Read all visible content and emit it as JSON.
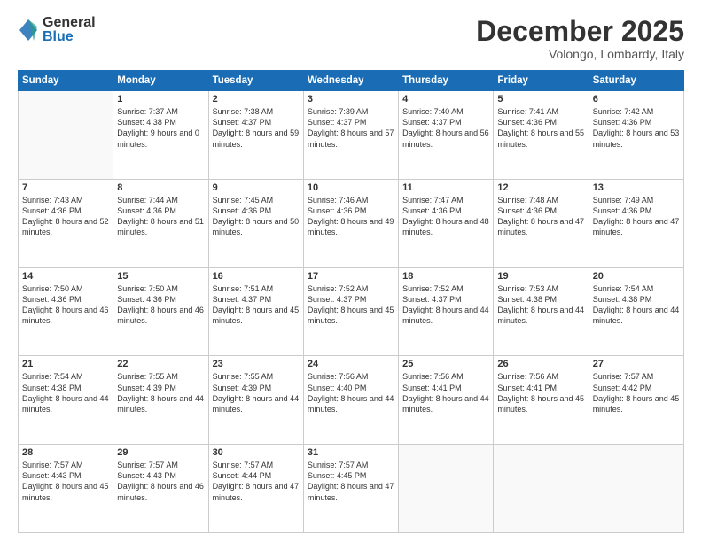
{
  "logo": {
    "general": "General",
    "blue": "Blue"
  },
  "header": {
    "month": "December 2025",
    "location": "Volongo, Lombardy, Italy"
  },
  "weekdays": [
    "Sunday",
    "Monday",
    "Tuesday",
    "Wednesday",
    "Thursday",
    "Friday",
    "Saturday"
  ],
  "weeks": [
    [
      {
        "day": "",
        "sunrise": "",
        "sunset": "",
        "daylight": ""
      },
      {
        "day": "1",
        "sunrise": "Sunrise: 7:37 AM",
        "sunset": "Sunset: 4:38 PM",
        "daylight": "Daylight: 9 hours and 0 minutes."
      },
      {
        "day": "2",
        "sunrise": "Sunrise: 7:38 AM",
        "sunset": "Sunset: 4:37 PM",
        "daylight": "Daylight: 8 hours and 59 minutes."
      },
      {
        "day": "3",
        "sunrise": "Sunrise: 7:39 AM",
        "sunset": "Sunset: 4:37 PM",
        "daylight": "Daylight: 8 hours and 57 minutes."
      },
      {
        "day": "4",
        "sunrise": "Sunrise: 7:40 AM",
        "sunset": "Sunset: 4:37 PM",
        "daylight": "Daylight: 8 hours and 56 minutes."
      },
      {
        "day": "5",
        "sunrise": "Sunrise: 7:41 AM",
        "sunset": "Sunset: 4:36 PM",
        "daylight": "Daylight: 8 hours and 55 minutes."
      },
      {
        "day": "6",
        "sunrise": "Sunrise: 7:42 AM",
        "sunset": "Sunset: 4:36 PM",
        "daylight": "Daylight: 8 hours and 53 minutes."
      }
    ],
    [
      {
        "day": "7",
        "sunrise": "Sunrise: 7:43 AM",
        "sunset": "Sunset: 4:36 PM",
        "daylight": "Daylight: 8 hours and 52 minutes."
      },
      {
        "day": "8",
        "sunrise": "Sunrise: 7:44 AM",
        "sunset": "Sunset: 4:36 PM",
        "daylight": "Daylight: 8 hours and 51 minutes."
      },
      {
        "day": "9",
        "sunrise": "Sunrise: 7:45 AM",
        "sunset": "Sunset: 4:36 PM",
        "daylight": "Daylight: 8 hours and 50 minutes."
      },
      {
        "day": "10",
        "sunrise": "Sunrise: 7:46 AM",
        "sunset": "Sunset: 4:36 PM",
        "daylight": "Daylight: 8 hours and 49 minutes."
      },
      {
        "day": "11",
        "sunrise": "Sunrise: 7:47 AM",
        "sunset": "Sunset: 4:36 PM",
        "daylight": "Daylight: 8 hours and 48 minutes."
      },
      {
        "day": "12",
        "sunrise": "Sunrise: 7:48 AM",
        "sunset": "Sunset: 4:36 PM",
        "daylight": "Daylight: 8 hours and 47 minutes."
      },
      {
        "day": "13",
        "sunrise": "Sunrise: 7:49 AM",
        "sunset": "Sunset: 4:36 PM",
        "daylight": "Daylight: 8 hours and 47 minutes."
      }
    ],
    [
      {
        "day": "14",
        "sunrise": "Sunrise: 7:50 AM",
        "sunset": "Sunset: 4:36 PM",
        "daylight": "Daylight: 8 hours and 46 minutes."
      },
      {
        "day": "15",
        "sunrise": "Sunrise: 7:50 AM",
        "sunset": "Sunset: 4:36 PM",
        "daylight": "Daylight: 8 hours and 46 minutes."
      },
      {
        "day": "16",
        "sunrise": "Sunrise: 7:51 AM",
        "sunset": "Sunset: 4:37 PM",
        "daylight": "Daylight: 8 hours and 45 minutes."
      },
      {
        "day": "17",
        "sunrise": "Sunrise: 7:52 AM",
        "sunset": "Sunset: 4:37 PM",
        "daylight": "Daylight: 8 hours and 45 minutes."
      },
      {
        "day": "18",
        "sunrise": "Sunrise: 7:52 AM",
        "sunset": "Sunset: 4:37 PM",
        "daylight": "Daylight: 8 hours and 44 minutes."
      },
      {
        "day": "19",
        "sunrise": "Sunrise: 7:53 AM",
        "sunset": "Sunset: 4:38 PM",
        "daylight": "Daylight: 8 hours and 44 minutes."
      },
      {
        "day": "20",
        "sunrise": "Sunrise: 7:54 AM",
        "sunset": "Sunset: 4:38 PM",
        "daylight": "Daylight: 8 hours and 44 minutes."
      }
    ],
    [
      {
        "day": "21",
        "sunrise": "Sunrise: 7:54 AM",
        "sunset": "Sunset: 4:38 PM",
        "daylight": "Daylight: 8 hours and 44 minutes."
      },
      {
        "day": "22",
        "sunrise": "Sunrise: 7:55 AM",
        "sunset": "Sunset: 4:39 PM",
        "daylight": "Daylight: 8 hours and 44 minutes."
      },
      {
        "day": "23",
        "sunrise": "Sunrise: 7:55 AM",
        "sunset": "Sunset: 4:39 PM",
        "daylight": "Daylight: 8 hours and 44 minutes."
      },
      {
        "day": "24",
        "sunrise": "Sunrise: 7:56 AM",
        "sunset": "Sunset: 4:40 PM",
        "daylight": "Daylight: 8 hours and 44 minutes."
      },
      {
        "day": "25",
        "sunrise": "Sunrise: 7:56 AM",
        "sunset": "Sunset: 4:41 PM",
        "daylight": "Daylight: 8 hours and 44 minutes."
      },
      {
        "day": "26",
        "sunrise": "Sunrise: 7:56 AM",
        "sunset": "Sunset: 4:41 PM",
        "daylight": "Daylight: 8 hours and 45 minutes."
      },
      {
        "day": "27",
        "sunrise": "Sunrise: 7:57 AM",
        "sunset": "Sunset: 4:42 PM",
        "daylight": "Daylight: 8 hours and 45 minutes."
      }
    ],
    [
      {
        "day": "28",
        "sunrise": "Sunrise: 7:57 AM",
        "sunset": "Sunset: 4:43 PM",
        "daylight": "Daylight: 8 hours and 45 minutes."
      },
      {
        "day": "29",
        "sunrise": "Sunrise: 7:57 AM",
        "sunset": "Sunset: 4:43 PM",
        "daylight": "Daylight: 8 hours and 46 minutes."
      },
      {
        "day": "30",
        "sunrise": "Sunrise: 7:57 AM",
        "sunset": "Sunset: 4:44 PM",
        "daylight": "Daylight: 8 hours and 47 minutes."
      },
      {
        "day": "31",
        "sunrise": "Sunrise: 7:57 AM",
        "sunset": "Sunset: 4:45 PM",
        "daylight": "Daylight: 8 hours and 47 minutes."
      },
      {
        "day": "",
        "sunrise": "",
        "sunset": "",
        "daylight": ""
      },
      {
        "day": "",
        "sunrise": "",
        "sunset": "",
        "daylight": ""
      },
      {
        "day": "",
        "sunrise": "",
        "sunset": "",
        "daylight": ""
      }
    ]
  ]
}
